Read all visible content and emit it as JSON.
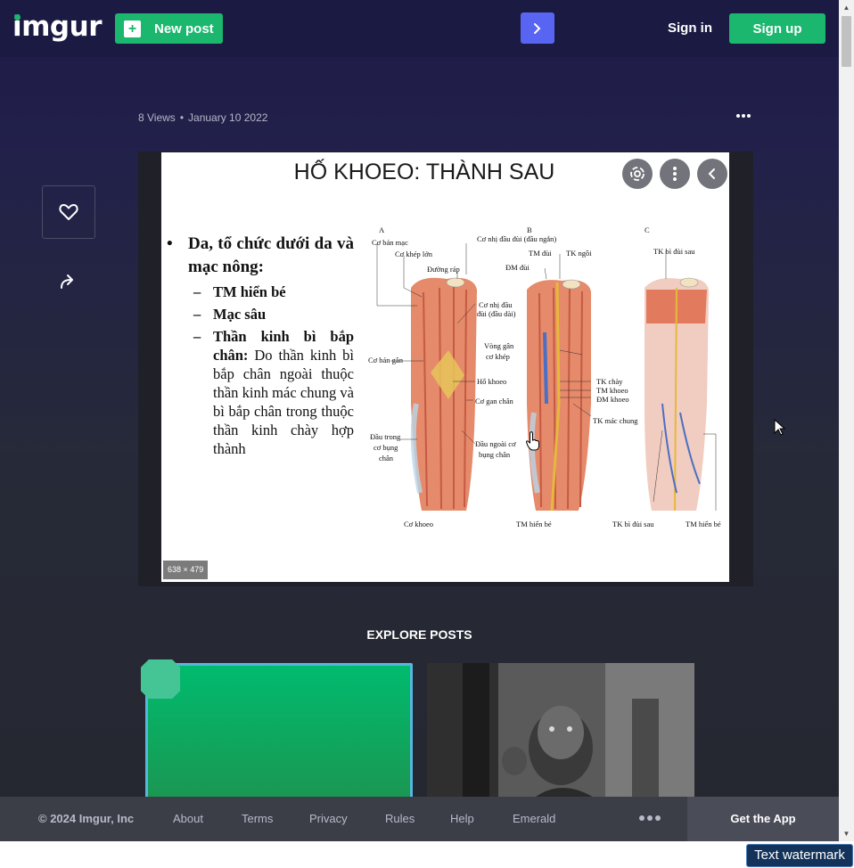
{
  "header": {
    "logo": "imgur",
    "new_post_label": "New post",
    "sign_in_label": "Sign in",
    "sign_up_label": "Sign up"
  },
  "post": {
    "views": "8 Views",
    "separator": "•",
    "date": "January 10 2022"
  },
  "image": {
    "size_label": "638 × 479",
    "slide_title": "HỐ KHOEO: THÀNH SAU",
    "bullet_main": "Da, tổ chức dưới da và mạc nông:",
    "sub_1": "TM hiển bé",
    "sub_2": "Mạc sâu",
    "sub_3_bold": "Thần kinh bì bắp chân:",
    "sub_3_text": "Do thần kinh bì bắp chân ngoài thuộc thần kinh mác chung và bì bắp chân trong thuộc thần kinh chày hợp thành",
    "figure_labels": {
      "a": "A",
      "b": "B",
      "c": "C",
      "co_ban_mac": "Cơ bán mạc",
      "co_khep_lon": "Cơ khép lớn",
      "duong_rap": "Đường ráp",
      "co_nhi_dau_ngan": "Cơ nhị đầu đùi (đầu ngắn)",
      "tm_dui": "TM đùi",
      "tk_ngoi": "TK ngồi",
      "dm_dui": "ĐM đùi",
      "co_nhi_dau_dai_1": "Cơ nhị đầu",
      "co_nhi_dau_dai_2": "đùi (đầu dài)",
      "co_ban_gan": "Cơ bán gân",
      "vong_gan_1": "Vòng gân",
      "vong_gan_2": "cơ khép",
      "ho_khoeo": "Hố khoeo",
      "co_gan_chan": "Cơ gan chân",
      "dau_trong_1": "Đầu trong",
      "dau_trong_2": "cơ bụng",
      "dau_trong_3": "chân",
      "dau_ngoai_1": "Đầu ngoài cơ",
      "dau_ngoai_2": "bụng chân",
      "tk_chay": "TK chày",
      "tm_khoeo": "TM khoeo",
      "dm_khoeo": "ĐM khoeo",
      "tk_mac_chung": "TK mác chung",
      "tk_bi_dui_sau_top": "TK bì đùi sau",
      "co_khoeo": "Cơ khoeo",
      "tm_hien_be_b": "TM hiển bé",
      "tk_bi_dui_sau_bottom": "TK bì đùi sau",
      "tm_hien_be_c": "TM hiển bé"
    }
  },
  "explore": {
    "title": "EXPLORE POSTS"
  },
  "footer": {
    "copyright": "© 2024 Imgur, Inc",
    "about": "About",
    "terms": "Terms",
    "privacy": "Privacy",
    "rules": "Rules",
    "help": "Help",
    "emerald": "Emerald",
    "get_app": "Get the App"
  },
  "overlay": {
    "watermark": "Text watermark"
  },
  "colors": {
    "brand_green": "#1bb76e",
    "accent_blue": "#5865f2",
    "header_bg": "#1b1a42"
  }
}
